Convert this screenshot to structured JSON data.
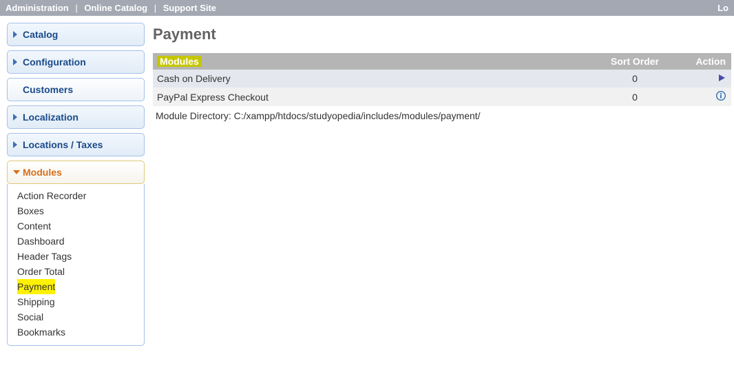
{
  "topbar": {
    "left": [
      "Administration",
      "Online Catalog",
      "Support Site"
    ],
    "right": "Lo"
  },
  "sidebar": {
    "items": [
      {
        "label": "Catalog",
        "state": "closed"
      },
      {
        "label": "Configuration",
        "state": "closed"
      },
      {
        "label": "Customers",
        "state": "closed-plain"
      },
      {
        "label": "Localization",
        "state": "closed"
      },
      {
        "label": "Locations / Taxes",
        "state": "closed"
      },
      {
        "label": "Modules",
        "state": "open",
        "children": [
          "Action Recorder",
          "Boxes",
          "Content",
          "Dashboard",
          "Header Tags",
          "Order Total",
          "Payment",
          "Shipping",
          "Social",
          "Bookmarks"
        ],
        "highlighted_child": "Payment"
      }
    ]
  },
  "page": {
    "title": "Payment",
    "table": {
      "headers": {
        "modules": "Modules",
        "sort": "Sort Order",
        "action": "Action"
      },
      "rows": [
        {
          "name": "Cash on Delivery",
          "sort": "0",
          "action_icon": "play",
          "selected": true
        },
        {
          "name": "PayPal Express Checkout",
          "sort": "0",
          "action_icon": "info",
          "selected": false
        }
      ]
    },
    "module_dir_label": "Module Directory: ",
    "module_dir_path": "C:/xampp/htdocs/studyopedia/includes/modules/payment/"
  }
}
